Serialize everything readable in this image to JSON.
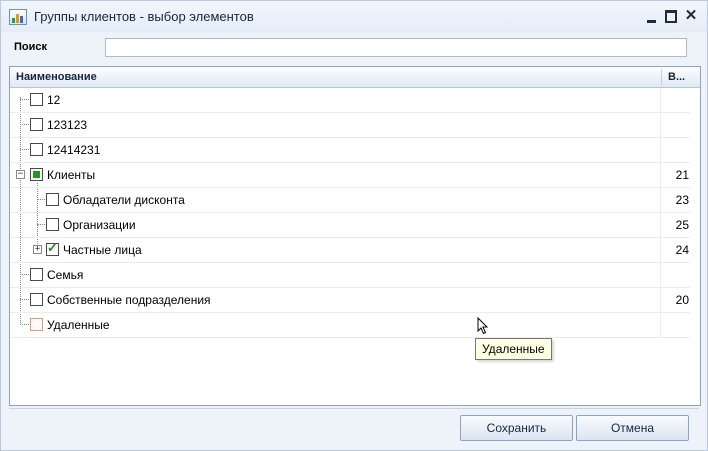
{
  "window": {
    "title": "Группы клиентов - выбор элементов"
  },
  "search": {
    "label": "Поиск",
    "value": "",
    "placeholder": ""
  },
  "grid": {
    "columns": [
      "Наименование",
      "В..."
    ],
    "rows": [
      {
        "label": "12",
        "value": "",
        "checkbox": "empty"
      },
      {
        "label": "123123",
        "value": "",
        "checkbox": "empty"
      },
      {
        "label": "12414231",
        "value": "",
        "checkbox": "empty"
      },
      {
        "label": "Клиенты",
        "value": "21",
        "checkbox": "partial",
        "expanded": true
      },
      {
        "label": "Обладатели дисконта",
        "value": "23",
        "checkbox": "empty"
      },
      {
        "label": "Организации",
        "value": "25",
        "checkbox": "empty"
      },
      {
        "label": "Частные лица",
        "value": "24",
        "checkbox": "checked",
        "expanded": false
      },
      {
        "label": "Семья",
        "value": "",
        "checkbox": "empty"
      },
      {
        "label": "Собственные подразделения",
        "value": "20",
        "checkbox": "empty"
      },
      {
        "label": "Удаленные",
        "value": "",
        "checkbox": "empty"
      }
    ]
  },
  "tooltip": {
    "text": "Удаленные"
  },
  "buttons": {
    "save": "Сохранить",
    "cancel": "Отмена"
  },
  "window_controls": {
    "minimize": "minimize-icon",
    "maximize": "maximize-icon",
    "close": "close-icon"
  }
}
